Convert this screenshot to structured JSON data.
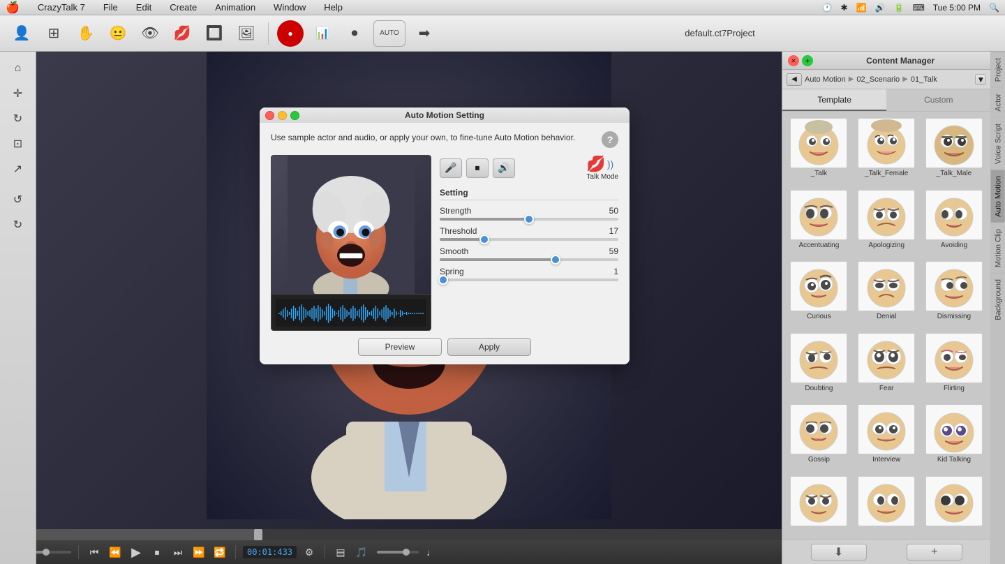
{
  "app": {
    "name": "CrazyTalk 7",
    "window_title": "default.ct7Project",
    "time": "Tue 5:00 PM"
  },
  "menubar": {
    "apple": "🍎",
    "items": [
      "CrazyTalk 7",
      "File",
      "Edit",
      "Create",
      "Animation",
      "Window",
      "Help"
    ]
  },
  "toolbar": {
    "icons": [
      "👤",
      "⊞",
      "✋",
      "👁",
      "👁",
      "💋",
      "🔲",
      "🖼"
    ],
    "record_label": "●",
    "auto_label": "AUTO"
  },
  "left_tools": [
    "⌂",
    "✛",
    "↻",
    "⊡",
    "↗",
    "↺",
    "↻"
  ],
  "dialog": {
    "title": "Auto Motion Setting",
    "description": "Use sample actor and audio, or apply your own, to fine-tune Auto Motion behavior.",
    "setting_label": "Setting",
    "strength_label": "Strength",
    "strength_value": "50",
    "threshold_label": "Threshold",
    "threshold_value": "17",
    "smooth_label": "Smooth",
    "smooth_value": "59",
    "spring_label": "Spring",
    "spring_value": "1",
    "strength_pct": 50,
    "threshold_pct": 25,
    "smooth_pct": 65,
    "spring_pct": 2,
    "talk_mode_label": "Talk Mode",
    "preview_btn": "Preview",
    "apply_btn": "Apply"
  },
  "content_manager": {
    "title": "Content Manager",
    "breadcrumb": {
      "back": "◀",
      "items": [
        "Auto Motion",
        "02_Scenario",
        "01_Talk"
      ],
      "separators": [
        "▶",
        "▶"
      ]
    },
    "tabs": {
      "template": "Template",
      "custom": "Custom"
    },
    "sidebar_labels": [
      "Project",
      "Actor",
      "Voice Script",
      "Auto Motion",
      "Motion Clip",
      "Background"
    ],
    "active_sidebar": "Auto Motion",
    "items": [
      {
        "label": "_Talk",
        "row": 0
      },
      {
        "label": "_Talk_Female",
        "row": 0
      },
      {
        "label": "_Talk_Male",
        "row": 0
      },
      {
        "label": "Accentuating",
        "row": 1
      },
      {
        "label": "Apologizing",
        "row": 1
      },
      {
        "label": "Avoiding",
        "row": 1
      },
      {
        "label": "Curious",
        "row": 2
      },
      {
        "label": "Denial",
        "row": 2
      },
      {
        "label": "Dismissing",
        "row": 2
      },
      {
        "label": "Doubting",
        "row": 3
      },
      {
        "label": "Fear",
        "row": 3
      },
      {
        "label": "Flirting",
        "row": 3
      },
      {
        "label": "Gossip",
        "row": 4
      },
      {
        "label": "Interview",
        "row": 4
      },
      {
        "label": "Kid Talking",
        "row": 4
      },
      {
        "label": "...",
        "row": 5
      },
      {
        "label": "...",
        "row": 5
      },
      {
        "label": "...",
        "row": 5
      }
    ],
    "bottom": {
      "download": "⬇",
      "add": "+"
    }
  },
  "timeline": {
    "timecode": "00:01:433",
    "position_pct": 33
  }
}
